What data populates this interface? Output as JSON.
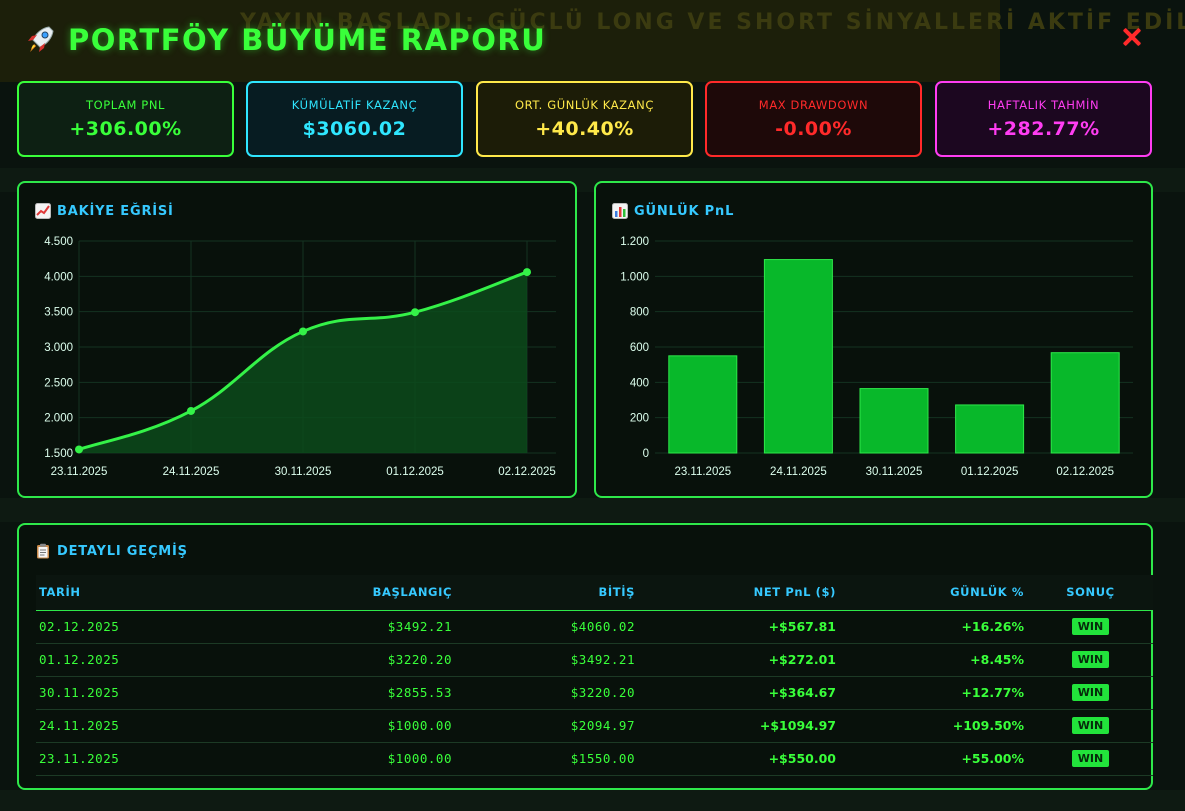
{
  "title": "PORTFÖY BÜYÜME RAPORU",
  "background": {
    "banner_text": "YAYIN BAŞLADI: GÜÇLÜ LONG VE SHORT SİNYALLERİ AKTİF EDİLDİ"
  },
  "colors": {
    "accent": "#39ff3a",
    "cyan": "#36c9ff",
    "yellow": "#ffe94a",
    "red": "#ff2a2a",
    "magenta": "#ff3df2",
    "bar": "#08b82a"
  },
  "stats": [
    {
      "label": "TOPLAM PnL",
      "value": "+306.00%",
      "color": "#39ff3a",
      "bg": "#0d2013"
    },
    {
      "label": "KÜMÜLATİF KAZANÇ",
      "value": "$3060.02",
      "color": "#2fe6ff",
      "bg": "#071c22"
    },
    {
      "label": "ORT. GÜNLÜK KAZANÇ",
      "value": "+40.40%",
      "color": "#ffe94a",
      "bg": "#1c1c07"
    },
    {
      "label": "MAX DRAWDOWN",
      "value": "-0.00%",
      "color": "#ff2a2a",
      "bg": "#1e0909"
    },
    {
      "label": "HAFTALIK TAHMİN",
      "value": "+282.77%",
      "color": "#ff3df2",
      "bg": "#1c0720"
    }
  ],
  "balance_panel": {
    "title": "BAKİYE EĞRİSİ",
    "icon": "chart-up-icon"
  },
  "daily_panel": {
    "title": "GÜNLÜK PnL",
    "icon": "bar-chart-icon"
  },
  "history_panel": {
    "title": "DETAYLI GEÇMİŞ",
    "icon": "clipboard-icon"
  },
  "chart_data": [
    {
      "type": "area",
      "categories": [
        "23.11.2025",
        "24.11.2025",
        "30.11.2025",
        "01.12.2025",
        "02.12.2025"
      ],
      "values": [
        1550.0,
        2094.97,
        3220.2,
        3492.21,
        4060.02
      ],
      "ylim": [
        1500,
        4500
      ],
      "yticks": [
        "4.500",
        "4.000",
        "3.500",
        "3.000",
        "2.500",
        "2.000",
        "1.500"
      ],
      "ytick_values": [
        4500,
        4000,
        3500,
        3000,
        2500,
        2000,
        1500
      ],
      "grid": true
    },
    {
      "type": "bar",
      "categories": [
        "23.11.2025",
        "24.11.2025",
        "30.11.2025",
        "01.12.2025",
        "02.12.2025"
      ],
      "values": [
        550.0,
        1094.97,
        364.67,
        272.01,
        567.81
      ],
      "ylim": [
        0,
        1200
      ],
      "yticks": [
        "1.200",
        "1.000",
        "800",
        "600",
        "400",
        "200",
        "0"
      ],
      "ytick_values": [
        1200,
        1000,
        800,
        600,
        400,
        200,
        0
      ],
      "grid": true
    }
  ],
  "table": {
    "headers": [
      "TARİH",
      "BAŞLANGIÇ",
      "BİTİŞ",
      "NET PnL ($)",
      "GÜNLÜK %",
      "SONUÇ"
    ],
    "rows": [
      [
        "02.12.2025",
        "$3492.21",
        "$4060.02",
        "+$567.81",
        "+16.26%",
        "WIN"
      ],
      [
        "01.12.2025",
        "$3220.20",
        "$3492.21",
        "+$272.01",
        "+8.45%",
        "WIN"
      ],
      [
        "30.11.2025",
        "$2855.53",
        "$3220.20",
        "+$364.67",
        "+12.77%",
        "WIN"
      ],
      [
        "24.11.2025",
        "$1000.00",
        "$2094.97",
        "+$1094.97",
        "+109.50%",
        "WIN"
      ],
      [
        "23.11.2025",
        "$1000.00",
        "$1550.00",
        "+$550.00",
        "+55.00%",
        "WIN"
      ]
    ]
  }
}
